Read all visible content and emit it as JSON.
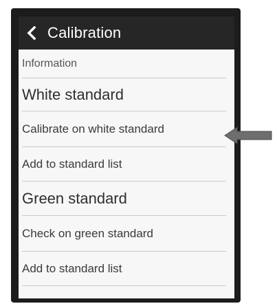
{
  "header": {
    "title": "Calibration",
    "back_icon": "chevron-left-icon"
  },
  "menu": {
    "information": "Information",
    "white_standard": "White standard",
    "calibrate_white": "Calibrate on white standard",
    "add_to_list_white": "Add to standard list",
    "green_standard": "Green standard",
    "check_green": "Check on green standard",
    "add_to_list_green": "Add to standard list"
  },
  "colors": {
    "header_bg": "#262626",
    "screen_bg": "#f7f7f7",
    "arrow": "#6e6e6e"
  },
  "annotation": {
    "arrow_icon": "arrow-left-icon"
  }
}
